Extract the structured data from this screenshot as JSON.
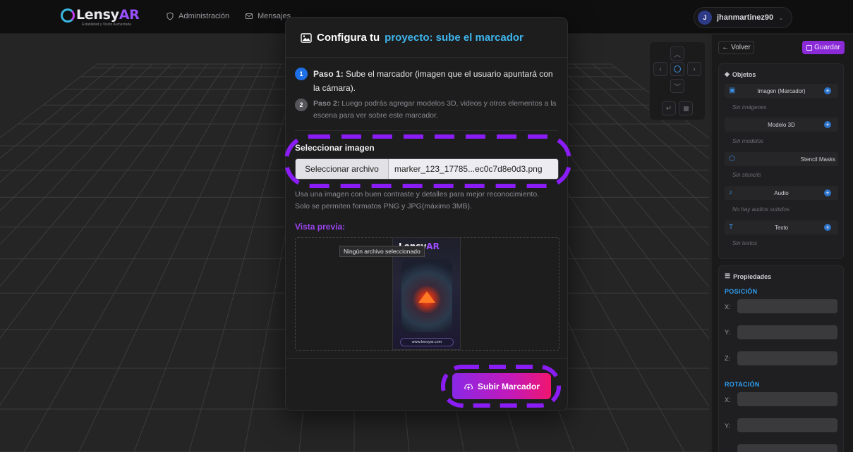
{
  "header": {
    "logo_text": "Lensy",
    "logo_accent": "AR",
    "logo_tagline": "Estabilidad y Visión Aumentada",
    "nav": [
      {
        "label": "Administración",
        "icon": "shield-icon"
      },
      {
        "label": "Mensajes",
        "icon": "mail-icon"
      }
    ],
    "user": {
      "initial": "J",
      "name": "jhanmartinez90"
    }
  },
  "toolbar": {
    "back_label": "Volver",
    "save_label": "Guardar"
  },
  "objects": {
    "title": "Objetos",
    "items": [
      {
        "label": "Imagen (Marcador)",
        "empty": "Sin imágenes",
        "icon": "image-icon"
      },
      {
        "label": "Modelo 3D",
        "empty": "Sin modelos",
        "icon": ""
      },
      {
        "label": "Stencil Masks",
        "empty": "Sin stencils",
        "icon": "pentagon-icon"
      },
      {
        "label": "Audio",
        "empty": "No hay audios subidos",
        "icon": "music-note-icon"
      },
      {
        "label": "Texto",
        "empty": "Sin textos",
        "icon": "text-icon"
      }
    ]
  },
  "properties": {
    "title": "Propiedades",
    "position_title": "POSICIÓN",
    "rotation_title": "ROTACIÓN",
    "axes": [
      "X:",
      "Y:",
      "Z:"
    ]
  },
  "modal": {
    "title_prefix": "Configura tu",
    "title_highlight": "proyecto: sube el marcador",
    "step1_num": "1",
    "step1_bold": "Paso 1:",
    "step1_text": "Sube el marcador (imagen que el usuario apuntará con la cámara).",
    "step2_num": "2",
    "step2_bold": "Paso 2:",
    "step2_text": "Luego podrás agregar modelos 3D, videos y otros elementos a la escena para ver sobre este marcador.",
    "select_label": "Seleccionar imagen",
    "file_button": "Seleccionar archivo",
    "file_name": "marker_123_17785...ec0c7d8e0d3.png",
    "hint_line1": "Usa una imagen con buen contraste y detalles para mejor reconocimiento.",
    "hint_line2": "Solo se permiten formatos PNG y JPG(máximo 3MB).",
    "preview_label": "Vista previa:",
    "tooltip": "Ningún archivo seleccionado",
    "card_logo": "Lensy",
    "card_logo_accent": "AR",
    "card_url": "www.lensyar.com",
    "upload_label": "Subir Marcador"
  },
  "colors": {
    "accent_purple": "#8b2bd8",
    "accent_blue": "#3fb5ec",
    "highlight_dash": "#8a1cf5",
    "upload_gradient_end": "#f0166e"
  }
}
